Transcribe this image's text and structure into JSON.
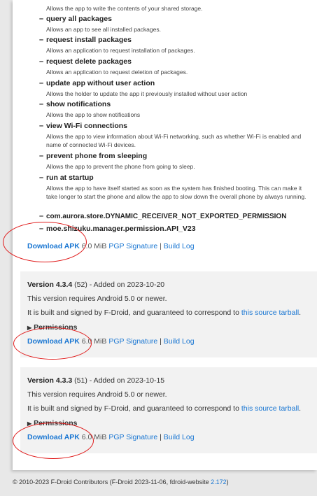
{
  "permissions": [
    {
      "title": "",
      "desc": "Allows the app to write the contents of your shared storage."
    },
    {
      "title": "query all packages",
      "desc": "Allows an app to see all installed packages."
    },
    {
      "title": "request install packages",
      "desc": "Allows an application to request installation of packages."
    },
    {
      "title": "request delete packages",
      "desc": "Allows an application to request deletion of packages."
    },
    {
      "title": "update app without user action",
      "desc": "Allows the holder to update the app it previously installed without user action"
    },
    {
      "title": "show notifications",
      "desc": "Allows the app to show notifications"
    },
    {
      "title": "view Wi-Fi connections",
      "desc": "Allows the app to view information about Wi-Fi networking, such as whether Wi-Fi is enabled and name of connected Wi-Fi devices."
    },
    {
      "title": "prevent phone from sleeping",
      "desc": "Allows the app to prevent the phone from going to sleep."
    },
    {
      "title": "run at startup",
      "desc": "Allows the app to have itself started as soon as the system has finished booting. This can make it take longer to start the phone and allow the app to slow down the overall phone by always running."
    },
    {
      "title": "com.aurora.store.DYNAMIC_RECEIVER_NOT_EXPORTED_PERMISSION",
      "desc": ""
    },
    {
      "title": "moe.shizuku.manager.permission.API_V23",
      "desc": ""
    }
  ],
  "download": {
    "apk_label": "Download APK",
    "size": "6.0 MiB",
    "pgp_label": "PGP Signature",
    "separator": "|",
    "buildlog_label": "Build Log"
  },
  "versions": [
    {
      "version_label": "Version 4.3.4",
      "meta": "(52) - Added on 2023-10-20",
      "requires": "This version requires Android 5.0 or newer.",
      "built_prefix": "It is built and signed by F-Droid, and guaranteed to correspond to",
      "tarball_label": "this source tarball",
      "built_suffix": ".",
      "permissions_label": "Permissions",
      "size": "6.0 MiB"
    },
    {
      "version_label": "Version 4.3.3",
      "meta": "(51) - Added on 2023-10-15",
      "requires": "This version requires Android 5.0 or newer.",
      "built_prefix": "It is built and signed by F-Droid, and guaranteed to correspond to",
      "tarball_label": "this source tarball",
      "built_suffix": ".",
      "permissions_label": "Permissions",
      "size": "6.0 MiB"
    }
  ],
  "footer": {
    "text": "© 2010-2023 F-Droid Contributors (F-Droid 2023-11-06, fdroid-website",
    "version_link": "2.172",
    "close": ")"
  },
  "colors": {
    "link": "#1976d2",
    "highlight_ring": "#e01b1b",
    "card_bg": "#f2f2f2"
  }
}
